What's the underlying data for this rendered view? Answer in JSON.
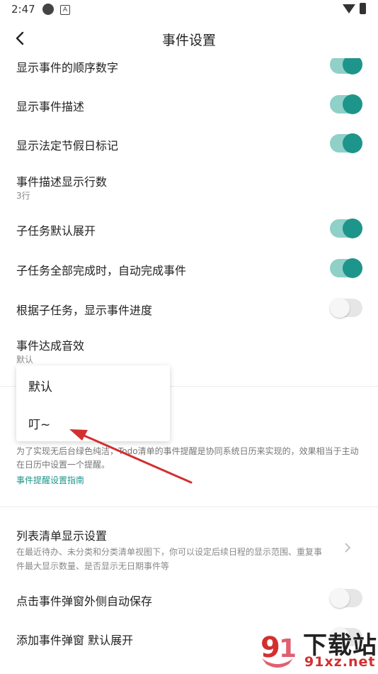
{
  "status_bar": {
    "time": "2:47"
  },
  "app_bar": {
    "title": "事件设置"
  },
  "settings": [
    {
      "label": "显示事件的顺序数字",
      "toggle": "on"
    },
    {
      "label": "显示事件描述",
      "toggle": "on"
    },
    {
      "label": "显示法定节假日标记",
      "toggle": "on"
    },
    {
      "label": "事件描述显示行数",
      "sub": "3行"
    },
    {
      "label": "子任务默认展开",
      "toggle": "on"
    },
    {
      "label": "子任务全部完成时，自动完成事件",
      "toggle": "on"
    },
    {
      "label": "根据子任务，显示事件进度",
      "toggle": "off"
    },
    {
      "label": "事件达成音效",
      "sub": "默认"
    }
  ],
  "popup": {
    "options": [
      "默认",
      "叮~"
    ]
  },
  "notice": {
    "text": "为了实现无后台绿色纯洁，Todo清单的事件提醒是协同系统日历来实现的，效果相当于主动在日历中设置一个提醒。",
    "link": "事件提醒设置指南"
  },
  "list_settings": {
    "label": "列表清单显示设置",
    "sub": "在最近待办、未分类和分类清单视图下，你可以设定后续日程的显示范围、重复事件最大显示数量、是否显示无日期事件等"
  },
  "bottom_settings": [
    {
      "label": "点击事件弹窗外侧自动保存",
      "toggle": "off"
    },
    {
      "label": "添加事件弹窗 默认展开",
      "toggle": "off"
    }
  ],
  "watermark": {
    "title": "下载站",
    "url": "91xz.net"
  },
  "colors": {
    "accent": "#1e958b",
    "toggle_track_on": "#8fd0c8",
    "arrow": "#d32f2f"
  }
}
